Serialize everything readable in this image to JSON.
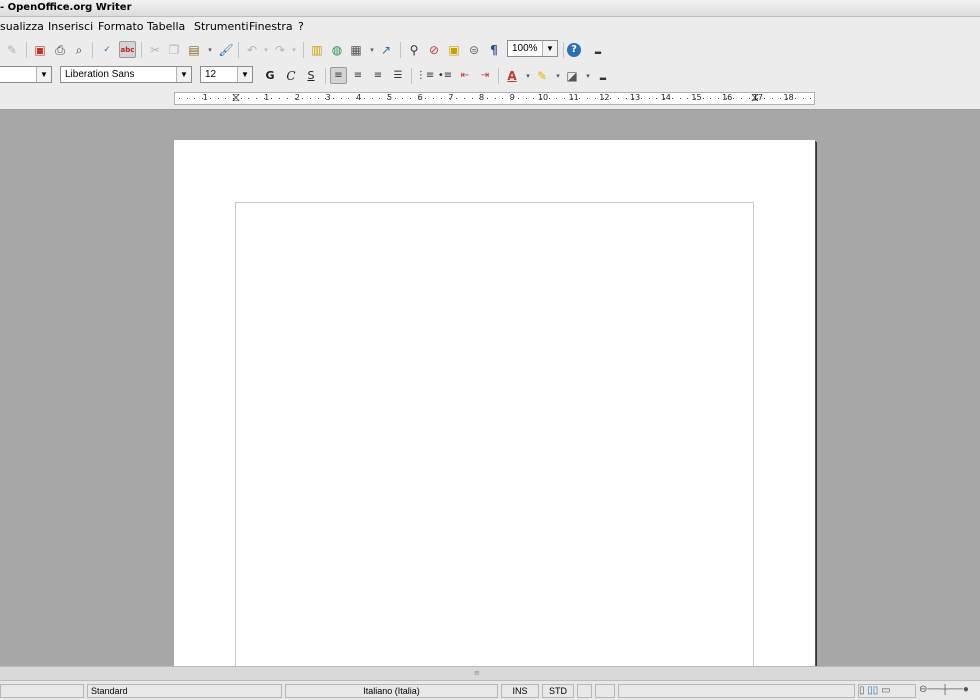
{
  "window": {
    "title": "- OpenOffice.org Writer"
  },
  "menu": [
    "sualizza",
    "Inserisci",
    "Formato",
    "Tabella",
    "Strumenti",
    "Finestra",
    "?"
  ],
  "standard_toolbar": {
    "zoom": "100%"
  },
  "format_toolbar": {
    "style_value": "",
    "font_name": "Liberation Sans",
    "font_size": "12",
    "bold": "G",
    "italic": "C",
    "underline": "S"
  },
  "ruler": {
    "labels": [
      "1",
      "1",
      "2",
      "3",
      "4",
      "5",
      "6",
      "7",
      "8",
      "9",
      "10",
      "11",
      "12",
      "13",
      "14",
      "15",
      "16",
      "17",
      "18"
    ]
  },
  "statusbar": {
    "page_style": "Standard",
    "language": "Italiano (Italia)",
    "insert_mode": "INS",
    "selection_mode": "STD"
  }
}
